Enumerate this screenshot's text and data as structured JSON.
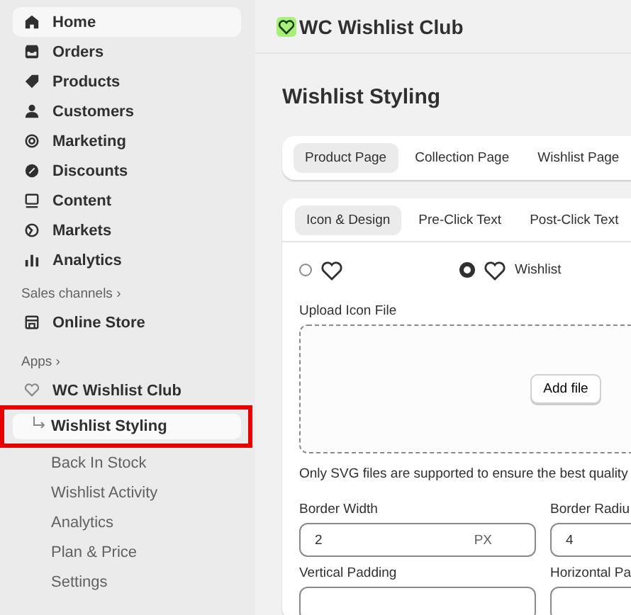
{
  "sidebar": {
    "items": [
      {
        "label": "Home",
        "selected": true
      },
      {
        "label": "Orders",
        "selected": false
      },
      {
        "label": "Products",
        "selected": false
      },
      {
        "label": "Customers",
        "selected": false
      },
      {
        "label": "Marketing",
        "selected": false
      },
      {
        "label": "Discounts",
        "selected": false
      },
      {
        "label": "Content",
        "selected": false
      },
      {
        "label": "Markets",
        "selected": false
      },
      {
        "label": "Analytics",
        "selected": false
      }
    ],
    "sales_channels": {
      "heading": "Sales channels ›",
      "items": [
        {
          "label": "Online Store",
          "selected": false
        }
      ]
    },
    "apps": {
      "heading": "Apps ›",
      "app": {
        "label": "WC Wishlist Club",
        "children": [
          {
            "label": "Wishlist Styling",
            "selected": true,
            "highlighted": true
          },
          {
            "label": "Back In Stock",
            "selected": false,
            "highlighted": false
          },
          {
            "label": "Wishlist Activity",
            "selected": false,
            "highlighted": false
          },
          {
            "label": "Analytics",
            "selected": false,
            "highlighted": false
          },
          {
            "label": "Plan & Price",
            "selected": false,
            "highlighted": false
          },
          {
            "label": "Settings",
            "selected": false,
            "highlighted": false
          }
        ]
      }
    }
  },
  "header": {
    "title": "WC Wishlist Club"
  },
  "page_title": "Wishlist Styling",
  "page_tabs": [
    {
      "label": "Product Page",
      "selected": true
    },
    {
      "label": "Collection Page",
      "selected": false
    },
    {
      "label": "Wishlist Page",
      "selected": false
    }
  ],
  "section_tabs": [
    {
      "label": "Icon & Design",
      "selected": true
    },
    {
      "label": "Pre-Click Text",
      "selected": false
    },
    {
      "label": "Post-Click Text",
      "selected": false
    }
  ],
  "icon_options": [
    {
      "selected": false
    },
    {
      "selected": true,
      "label": "Wishlist"
    }
  ],
  "upload": {
    "label": "Upload Icon File",
    "button": "Add file",
    "hint": "Only SVG files are supported to ensure the best quality"
  },
  "fields": [
    {
      "label": "Border Width",
      "value": "2",
      "suffix": "PX"
    },
    {
      "label": "Border Radiu",
      "value": "4"
    },
    {
      "label": "Vertical Padding"
    },
    {
      "label": "Horizontal Pa"
    }
  ]
}
